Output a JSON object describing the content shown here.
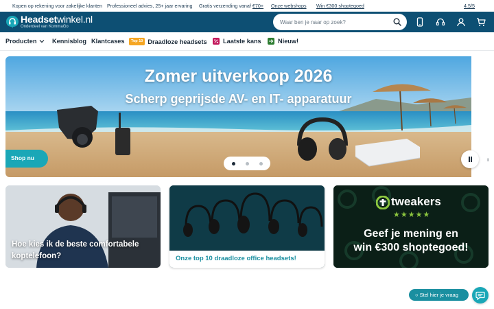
{
  "topbar": {
    "item1": "Kopen op rekening voor zakelijke klanten",
    "item2": "Professioneel advies, 25+ jaar ervaring",
    "item3_prefix": "Gratis verzending vanaf ",
    "item3_link": "€70+",
    "item4": "Onze webshops",
    "item5": "Win €300 shoptegoed",
    "rating": "4.5/5"
  },
  "header": {
    "logo_name_bold": "Headset",
    "logo_name_light": "winkel.nl",
    "logo_sub": "Onderdeel van KommaGo",
    "search_placeholder": "Waar ben je naar op zoek?",
    "icons": [
      "search-icon",
      "phone-icon",
      "headset-icon",
      "user-icon",
      "cart-icon"
    ]
  },
  "nav": {
    "products": "Producten",
    "knowledge": "Kennisblog",
    "cases": "Klantcases",
    "top10_badge": "Top 10",
    "wireless": "Draadloze headsets",
    "last_chance": "Laatste kans",
    "new": "Nieuw!"
  },
  "hero": {
    "title": "Zomer uitverkoop 2026",
    "subtitle": "Scherp geprijsde AV- en IT- apparatuur",
    "cta": "Shop nu",
    "slides": 3,
    "active_slide": 1
  },
  "cards": {
    "card1_text": "Hoe kies ik de beste comfortabele koptelefoon?",
    "card2_caption": "Onze top 10 draadloze office headsets!",
    "card3_brand": "tweakers",
    "card3_stars": "★★★★★",
    "card3_line1": "Geef je mening en",
    "card3_line2": "win €300 shoptegoed!"
  },
  "chat": {
    "label": "Stel hier je vraag"
  },
  "colors": {
    "brand_dark": "#0d4f73",
    "accent_teal": "#1aa7b7",
    "top10_badge": "#f5a623",
    "last_chance_badge": "#c2185b",
    "new_badge": "#2e7d32"
  }
}
